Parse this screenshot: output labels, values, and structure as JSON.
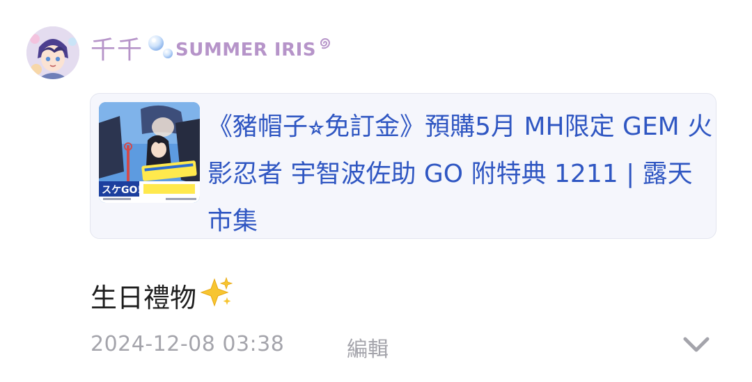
{
  "post": {
    "author": {
      "name_prefix": "千千",
      "name_latin": "SUMMER IRIS",
      "bubble_icon": "bubbles-icon",
      "swirl_icon": "swirl-icon"
    },
    "link_card": {
      "title": "《豬帽子⭐︎免訂金》預購5月 MH限定 GEM 火影忍者 宇智波佐助 GO 附特典 1211 | 露天市集",
      "thumbnail_banner": "スケGO!"
    },
    "text": "生日禮物",
    "text_emoji": "sparkles-icon",
    "timestamp": "2024-12-08 03:38",
    "edit_label": "編輯",
    "expand_icon": "chevron-down-icon"
  },
  "colors": {
    "author": "#b694c9",
    "link": "#2f56c2",
    "meta": "#a4a4ab",
    "card_bg": "#f5f6fc"
  }
}
